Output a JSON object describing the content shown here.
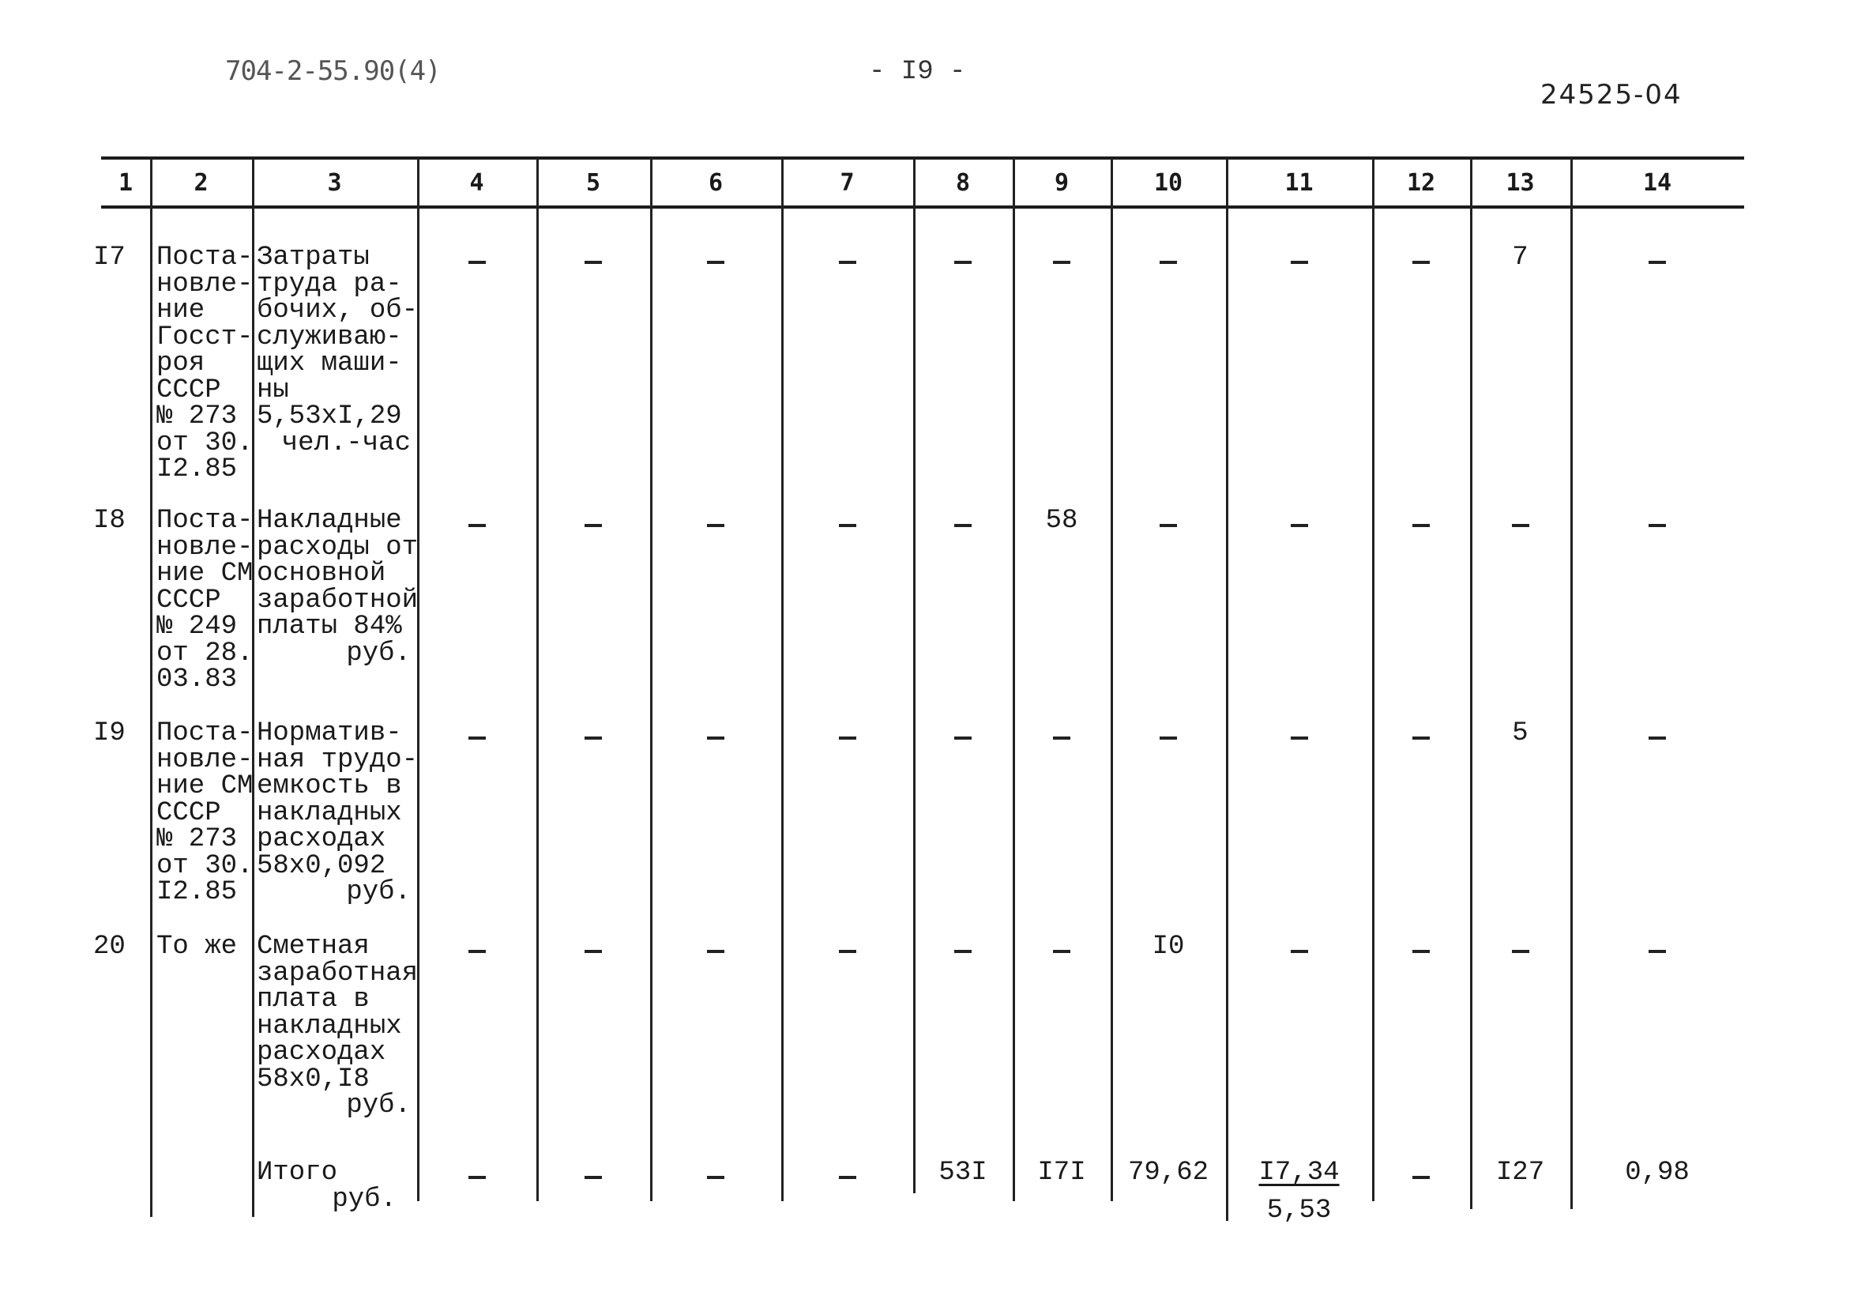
{
  "header": {
    "doc_code": "704-2-55.90(4)",
    "page_number": "- I9 -",
    "stamp_number": "24525-04"
  },
  "table": {
    "column_numbers": [
      "1",
      "2",
      "3",
      "4",
      "5",
      "6",
      "7",
      "8",
      "9",
      "10",
      "11",
      "12",
      "13",
      "14"
    ],
    "rows": [
      {
        "no": "I7",
        "basis": [
          "Поста-",
          "новле-",
          "ние",
          "Госст-",
          "роя",
          "СССР",
          "№ 273",
          "от 30.",
          "I2.85"
        ],
        "description": [
          "Затраты",
          "труда ра-",
          "бочих, об-",
          "служиваю-",
          "щих маши-",
          "ны",
          "5,53xI,29"
        ],
        "unit": "чел.-час",
        "values": [
          "-",
          "-",
          "-",
          "-",
          "-",
          "-",
          "-",
          "-",
          "-",
          "7",
          "-"
        ]
      },
      {
        "no": "I8",
        "basis": [
          "Поста-",
          "новле-",
          "ние СМ",
          "СССР",
          "№ 249",
          "от 28.",
          "03.83"
        ],
        "description": [
          "Накладные",
          "расходы от",
          "основной",
          "заработной",
          "платы 84%"
        ],
        "unit": "руб.",
        "values": [
          "-",
          "-",
          "-",
          "-",
          "-",
          "58",
          "-",
          "-",
          "-",
          "-",
          "-"
        ]
      },
      {
        "no": "I9",
        "basis": [
          "Поста-",
          "новле-",
          "ние СМ",
          "СССР",
          "№ 273",
          "от 30.",
          "I2.85"
        ],
        "description": [
          "Норматив-",
          "ная трудо-",
          "емкость в",
          "накладных",
          "расходах",
          "58x0,092"
        ],
        "unit": "руб.",
        "values": [
          "-",
          "-",
          "-",
          "-",
          "-",
          "-",
          "-",
          "-",
          "-",
          "5",
          "-"
        ]
      },
      {
        "no": "20",
        "basis": [
          "То же"
        ],
        "description": [
          "Сметная",
          "заработная",
          "плата в",
          "накладных",
          "расходах",
          "58x0,I8"
        ],
        "unit": "руб.",
        "values": [
          "-",
          "-",
          "-",
          "-",
          "-",
          "-",
          "I0",
          "-",
          "-",
          "-",
          "-"
        ]
      }
    ],
    "total": {
      "label": "Итого",
      "unit": "руб.",
      "values": [
        "-",
        "-",
        "-",
        "-",
        "53I",
        "I7I",
        "79,62",
        "I7,34",
        "-",
        "I27",
        "0,98"
      ],
      "col11_secondary": "5,53"
    }
  }
}
